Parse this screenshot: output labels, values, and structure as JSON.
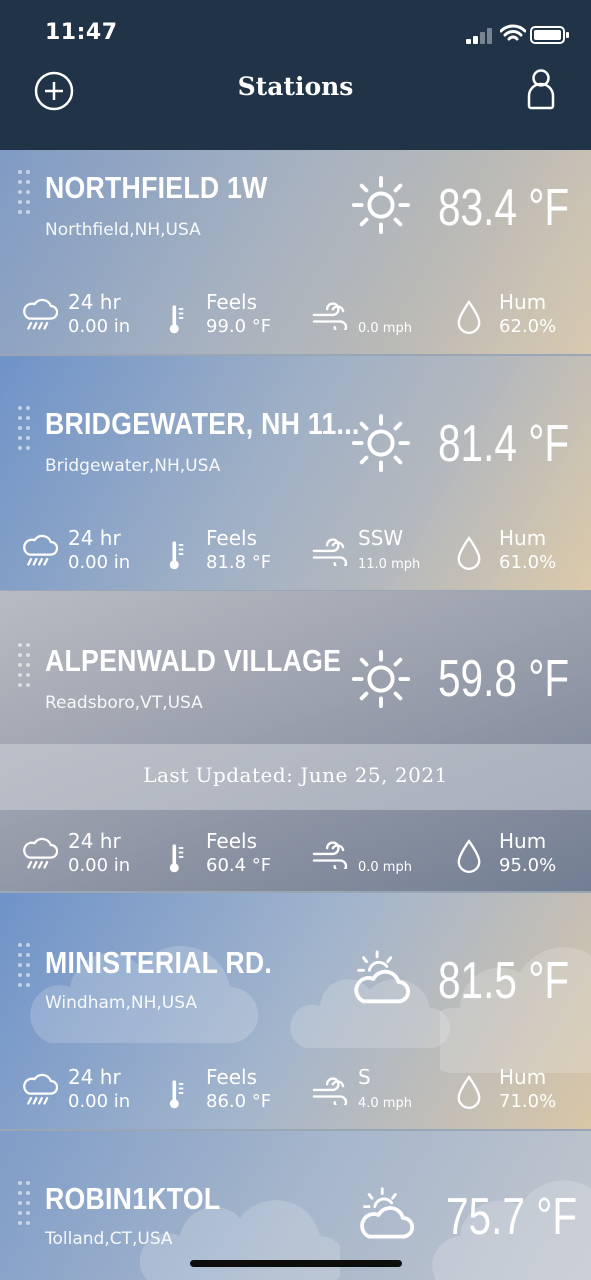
{
  "status_bar": {
    "time": "11:47"
  },
  "header": {
    "title": "Stations"
  },
  "stations": [
    {
      "name": "NORTHFIELD 1W",
      "location": "Northfield,NH,USA",
      "temp": "83.4 °F",
      "condition_icon": "sun-icon",
      "rain_label": "24 hr",
      "rain_value": "0.00 in",
      "feels_label": "Feels",
      "feels_value": "99.0 °F",
      "wind_dir": "",
      "wind_speed": "0.0 mph",
      "hum_label": "Hum",
      "hum_value": "62.0%"
    },
    {
      "name": "BRIDGEWATER, NH  11...",
      "location": "Bridgewater,NH,USA",
      "temp": "81.4 °F",
      "condition_icon": "sun-icon",
      "rain_label": "24 hr",
      "rain_value": "0.00 in",
      "feels_label": "Feels",
      "feels_value": "81.8 °F",
      "wind_dir": "SSW",
      "wind_speed": "11.0 mph",
      "hum_label": "Hum",
      "hum_value": "61.0%"
    },
    {
      "name": "ALPENWALD VILLAGE",
      "location": "Readsboro,VT,USA",
      "temp": "59.8 °F",
      "condition_icon": "sun-icon",
      "last_updated": "Last Updated: June 25, 2021",
      "rain_label": "24 hr",
      "rain_value": "0.00 in",
      "feels_label": "Feels",
      "feels_value": "60.4 °F",
      "wind_dir": "",
      "wind_speed": "0.0 mph",
      "hum_label": "Hum",
      "hum_value": "95.0%"
    },
    {
      "name": "MINISTERIAL RD.",
      "location": "Windham,NH,USA",
      "temp": "81.5 °F",
      "condition_icon": "partly-cloudy-icon",
      "rain_label": "24 hr",
      "rain_value": "0.00 in",
      "feels_label": "Feels",
      "feels_value": "86.0 °F",
      "wind_dir": "S",
      "wind_speed": "4.0 mph",
      "hum_label": "Hum",
      "hum_value": "71.0%"
    },
    {
      "name": "ROBIN1KTOL",
      "location": "Tolland,CT,USA",
      "temp": "75.7 °F",
      "condition_icon": "partly-cloudy-icon"
    }
  ]
}
